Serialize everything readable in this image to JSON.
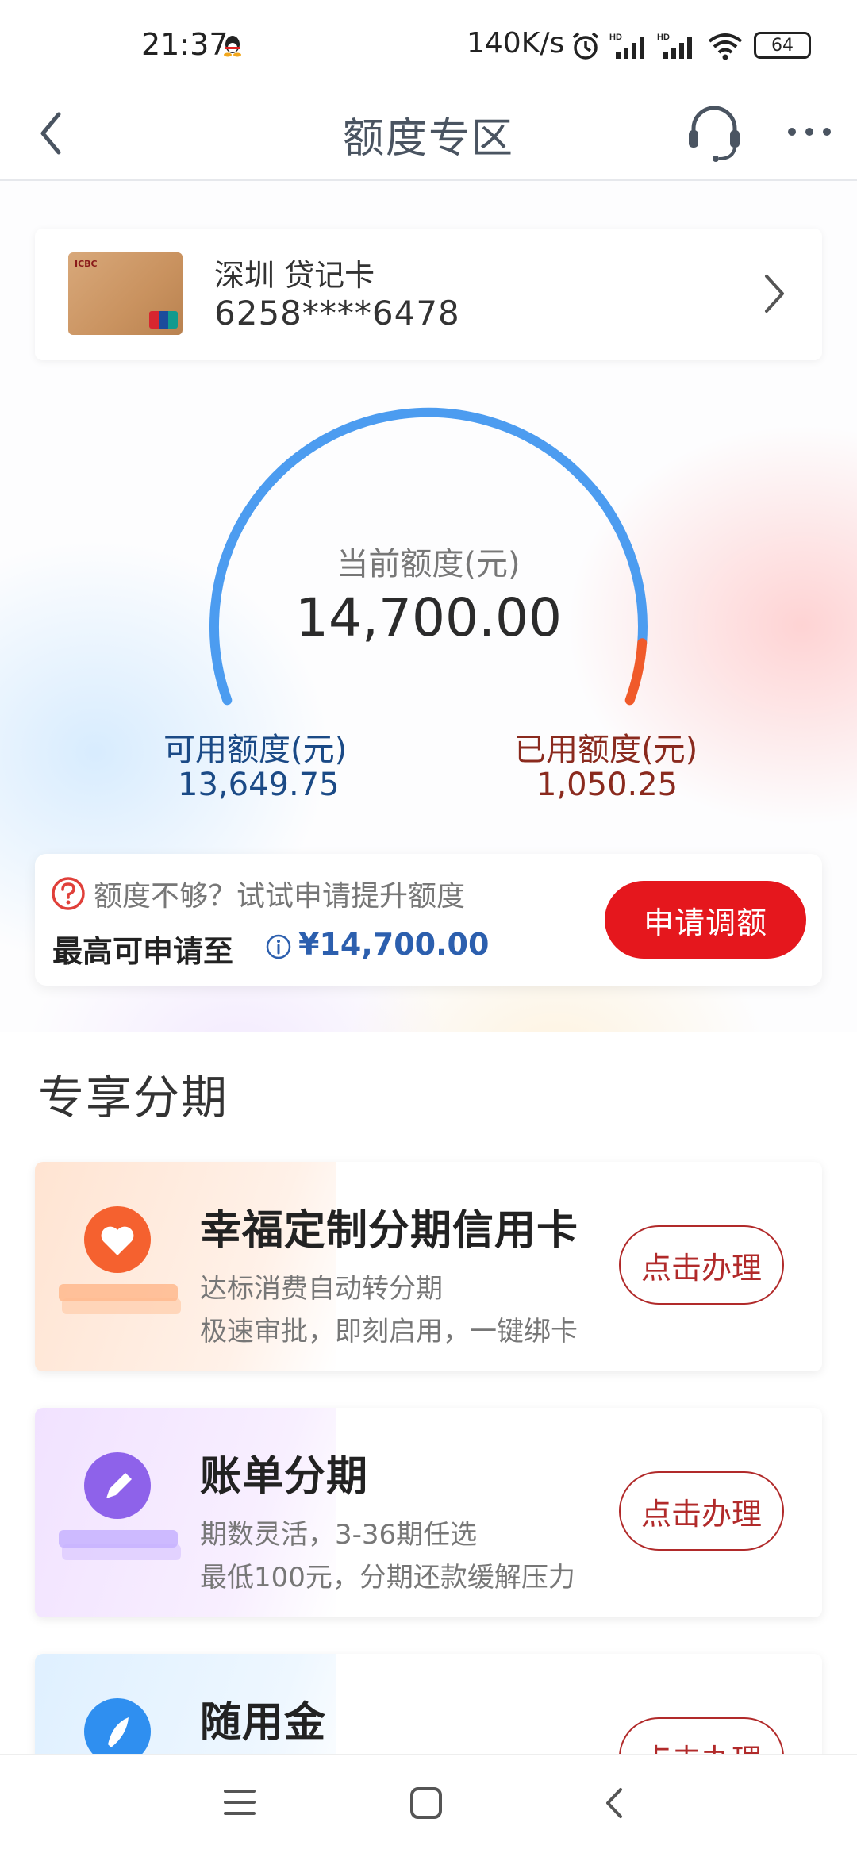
{
  "status_bar": {
    "time": "21:37",
    "network_speed": "140K/s",
    "battery": "64"
  },
  "nav": {
    "title": "额度专区"
  },
  "card": {
    "name": "深圳 贷记卡",
    "number": "6258****6478"
  },
  "gauge": {
    "label": "当前额度(元)",
    "value": "14,700.00",
    "used_fraction": 0.0714,
    "colors": {
      "available": "#4c9cf0",
      "used": "#f05a2a"
    }
  },
  "available": {
    "label": "可用额度(元)",
    "value": "13,649.75"
  },
  "used": {
    "label": "已用额度(元)",
    "value": "1,050.25"
  },
  "raise": {
    "hint": "额度不够？试试申请提升额度",
    "max_label": "最高可申请至",
    "max_value": "¥14,700.00",
    "apply_label": "申请调额"
  },
  "section": {
    "title": "专享分期"
  },
  "promos": [
    {
      "title": "幸福定制分期信用卡",
      "line1": "达标消费自动转分期",
      "line2": "极速审批，即刻启用，一键绑卡",
      "button": "点击办理"
    },
    {
      "title": "账单分期",
      "line1": "期数灵活，3-36期任选",
      "line2": "最低100元，分期还款缓解压力",
      "button": "点击办理"
    },
    {
      "title": "随用金",
      "button": "点击办理"
    }
  ],
  "colors": {
    "accent_red": "#e5171d",
    "brand_blue": "#2c5fae"
  }
}
